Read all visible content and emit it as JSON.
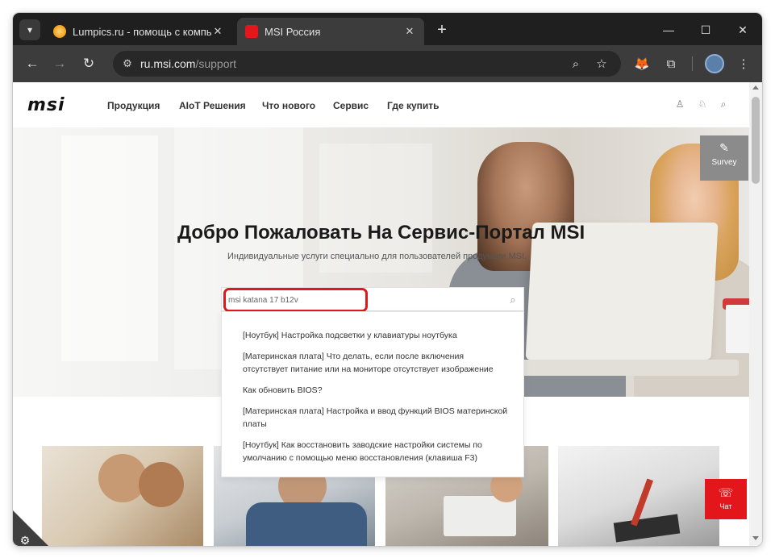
{
  "browser": {
    "tabs": [
      {
        "title": "Lumpics.ru - помощь с компь",
        "favicon": "lumpics-favicon-icon",
        "color": "#f5a623"
      },
      {
        "title": "MSI Россия",
        "favicon": "msi-favicon-icon",
        "color": "#e3171b"
      }
    ],
    "tab_close": "✕",
    "new_tab": "+",
    "url_domain": "ru.msi.com",
    "url_path": "/support",
    "window_controls": {
      "minimize": "—",
      "maximize": "☐",
      "close": "✕"
    }
  },
  "site": {
    "logo": "msi",
    "nav": [
      "Продукция",
      "AIoT Решения",
      "Что нового",
      "Сервис",
      "Где купить"
    ],
    "hero_title": "Добро Пожаловать На Сервис-Портал MSI",
    "hero_subtitle": "Индивидуальные услуги специально для пользователей продукции MSI.",
    "search_value": "msi katana 17 b12v",
    "suggestions": [
      "[Ноутбук] Настройка подсветки у клавиатуры ноутбука",
      "[Материнская плата] Что делать, если после включения отсутствует питание или на мониторе отсутствует изображение",
      "Как обновить BIOS?",
      "[Материнская плата] Настройка и ввод функций BIOS материнской платы",
      "[Ноутбук] Как восстановить заводские настройки системы по умолчанию с помощью меню восстановления (клавиша F3)"
    ],
    "survey_label": "Survey",
    "chat_label": "Чат",
    "accent_color": "#e3171b"
  }
}
